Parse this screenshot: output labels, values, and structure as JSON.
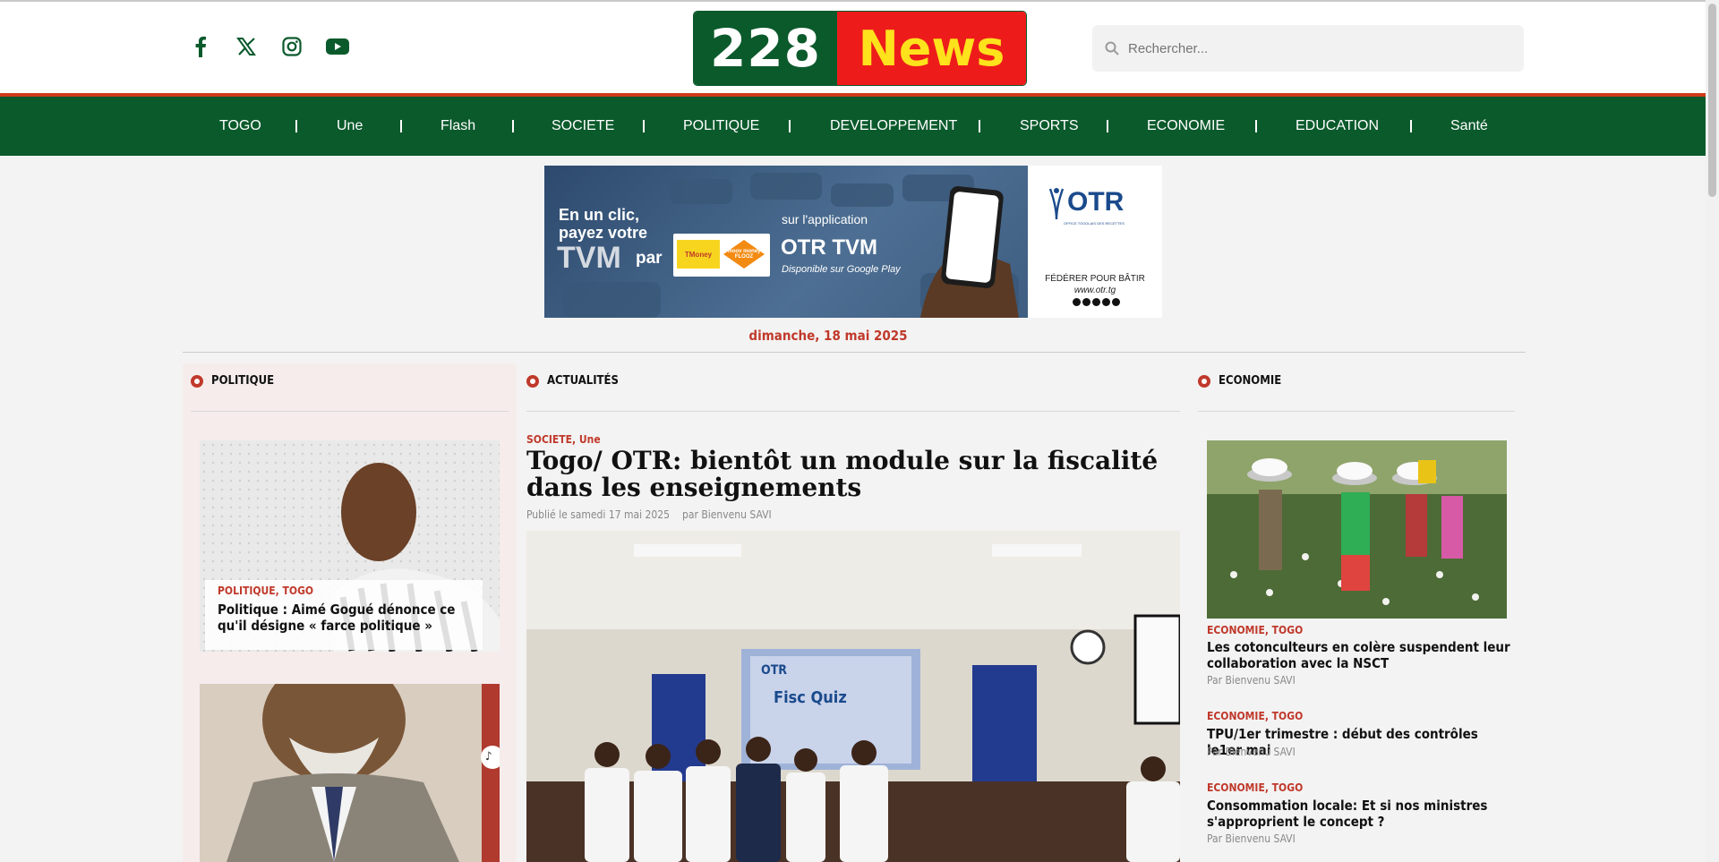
{
  "header": {
    "social": [
      "facebook-icon",
      "x-icon",
      "instagram-icon",
      "youtube-icon"
    ],
    "logo": {
      "left": "228",
      "right": "News"
    },
    "search_placeholder": "Rechercher..."
  },
  "nav": {
    "items": [
      "TOGO",
      "Une",
      "Flash",
      "SOCIETE",
      "POLITIQUE",
      "DEVELOPPEMENT",
      "SPORTS",
      "ECONOMIE",
      "EDUCATION",
      "Santé"
    ]
  },
  "banner": {
    "line1": "En un clic,",
    "line2": "payez votre",
    "line3": "TVM",
    "par": "par",
    "tmoney": "TMoney",
    "flooz": "moov money FLOOZ",
    "app_prefix": "sur l'application",
    "app_name": "OTR TVM",
    "app_sub": "Disponible sur Google Play",
    "brand": "OTR",
    "brand_sub": "OFFICE TOGOLAIS DES RECETTES",
    "slogan": "FÉDÉRER POUR BÂTIR",
    "site": "www.otr.tg"
  },
  "date": "dimanche, 18 mai 2025",
  "left": {
    "heading": "POLITIQUE",
    "card1": {
      "category": "POLITIQUE, TOGO",
      "title": "Politique : Aimé Gogué dénonce ce qu'il désigne « farce politique »"
    }
  },
  "center": {
    "heading": "ACTUALITÉS",
    "category": "SOCIETE, Une",
    "title": "Togo/ OTR: bientôt un module sur la fiscalité dans les enseignements",
    "published": "Publié le samedi 17 mai 2025",
    "author": "par Bienvenu SAVI",
    "photo_labels": {
      "otr": "OTR",
      "quiz": "Fisc Quiz"
    }
  },
  "right": {
    "heading": "ECONOMIE",
    "items": [
      {
        "category": "ECONOMIE, TOGO",
        "title": "Les cotonculteurs en colère suspendent leur collaboration avec la NSCT",
        "author": "Par Bienvenu SAVI"
      },
      {
        "category": "ECONOMIE, TOGO",
        "title": "TPU/1er trimestre : début des contrôles le1er mai",
        "author": "Par Bienvenu SAVI"
      },
      {
        "category": "ECONOMIE, TOGO",
        "title": "Consommation locale: Et si nos ministres s'approprient le concept ?",
        "author": "Par Bienvenu SAVI"
      }
    ]
  }
}
